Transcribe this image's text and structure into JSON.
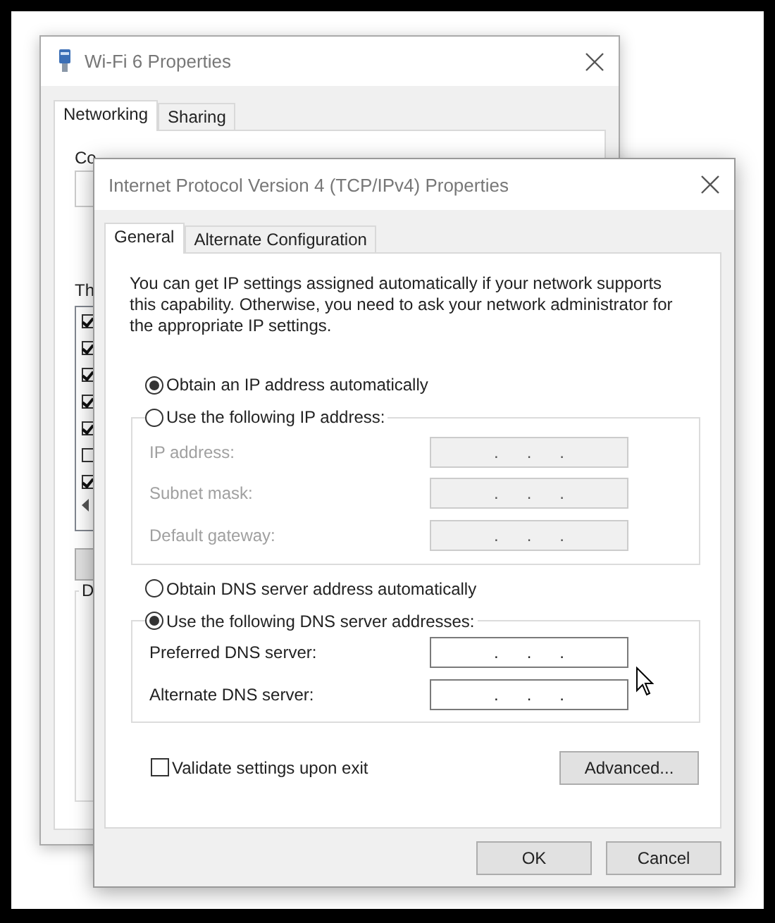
{
  "background_window": {
    "title": "Wi-Fi 6 Properties",
    "tabs": [
      {
        "label": "Networking",
        "selected": true
      },
      {
        "label": "Sharing",
        "selected": false
      }
    ],
    "connect_label": "Co",
    "items_label": "Th",
    "components": [
      {
        "checked": true
      },
      {
        "checked": true
      },
      {
        "checked": true
      },
      {
        "checked": true
      },
      {
        "checked": true
      },
      {
        "checked": false
      },
      {
        "checked": true
      }
    ],
    "group_label": "D"
  },
  "dialog": {
    "title": "Internet Protocol Version 4 (TCP/IPv4) Properties",
    "tabs": [
      {
        "label": "General",
        "selected": true
      },
      {
        "label": "Alternate Configuration",
        "selected": false
      }
    ],
    "description": "You can get IP settings assigned automatically if your network supports this capability. Otherwise, you need to ask your network administrator for the appropriate IP settings.",
    "ip_options": [
      {
        "label": "Obtain an IP address automatically",
        "selected": true
      },
      {
        "label": "Use the following IP address:",
        "selected": false
      }
    ],
    "ip_fields": [
      {
        "label": "IP address:",
        "value": ".      .      .",
        "disabled": true
      },
      {
        "label": "Subnet mask:",
        "value": ".      .      .",
        "disabled": true
      },
      {
        "label": "Default gateway:",
        "value": ".      .      .",
        "disabled": true
      }
    ],
    "dns_options": [
      {
        "label": "Obtain DNS server address automatically",
        "selected": false
      },
      {
        "label": "Use the following DNS server addresses:",
        "selected": true
      }
    ],
    "dns_fields": [
      {
        "label": "Preferred DNS server:",
        "value": ".      .      .",
        "disabled": false
      },
      {
        "label": "Alternate DNS server:",
        "value": ".      .      .",
        "disabled": false
      }
    ],
    "validate": {
      "label": "Validate settings upon exit",
      "checked": false
    },
    "advanced_button": "Advanced...",
    "buttons": [
      "OK",
      "Cancel"
    ]
  }
}
